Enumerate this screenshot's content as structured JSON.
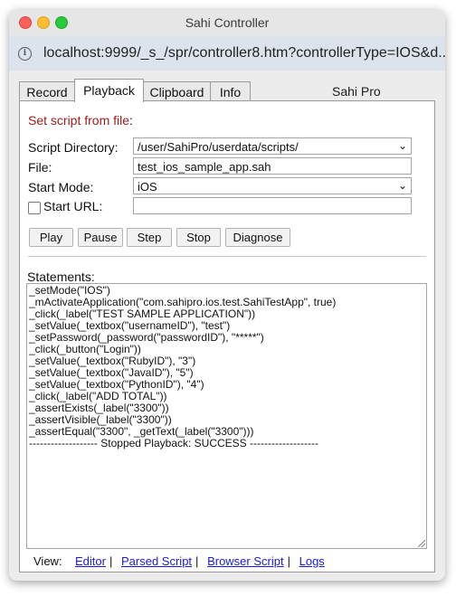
{
  "window": {
    "title": "Sahi Controller"
  },
  "url": "localhost:9999/_s_/spr/controller8.htm?controllerType=IOS&d...",
  "tabs": [
    {
      "label": "Record"
    },
    {
      "label": "Playback"
    },
    {
      "label": "Clipboard"
    },
    {
      "label": "Info"
    }
  ],
  "product": "Sahi Pro",
  "playback": {
    "set_script_label": "Set script from file",
    "set_script_colon": ":",
    "script_dir_label": "Script Directory:",
    "script_dir_value": "/user/SahiPro/userdata/scripts/",
    "file_label": "File:",
    "file_value": "test_ios_sample_app.sah",
    "start_mode_label": "Start Mode:",
    "start_mode_value": "iOS",
    "start_url_label": "Start URL:",
    "start_url_value": "",
    "buttons": {
      "play": "Play",
      "pause": "Pause",
      "step": "Step",
      "stop": "Stop",
      "diagnose": "Diagnose"
    },
    "statements_label": "Statements:",
    "statements": [
      "_setMode(\"IOS\")",
      "_mActivateApplication(\"com.sahipro.ios.test.SahiTestApp\", true)",
      "_click(_label(\"TEST SAMPLE APPLICATION\"))",
      "_setValue(_textbox(\"usernameID\"), \"test\")",
      "_setPassword(_password(\"passwordID\"), \"*****\")",
      "_click(_button(\"Login\"))",
      "_setValue(_textbox(\"RubyID\"), \"3\")",
      "_setValue(_textbox(\"JavaID\"), \"5\")",
      "_setValue(_textbox(\"PythonID\"), \"4\")",
      "_click(_label(\"ADD TOTAL\"))",
      "_assertExists(_label(\"3300\"))",
      "_assertVisible(_label(\"3300\"))",
      "_assertEqual(\"3300\", _getText(_label(\"3300\")))",
      "------------------- Stopped Playback: SUCCESS -------------------"
    ],
    "view_label": "View:",
    "view_links": {
      "editor": "Editor",
      "parsed_script": "Parsed Script",
      "browser_script": "Browser Script",
      "logs": "Logs"
    },
    "separator": "|"
  },
  "colors": {
    "accent_red": "#9b1b1b",
    "link_blue": "#1a1ae0"
  }
}
